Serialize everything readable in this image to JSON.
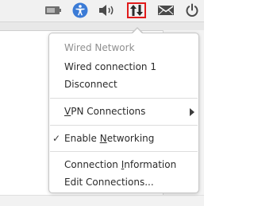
{
  "panel": {
    "icons": [
      {
        "name": "battery-icon",
        "color": "#5a5a5a"
      },
      {
        "name": "accessibility-icon",
        "color": "#3b7bd6"
      },
      {
        "name": "volume-icon",
        "color": "#4a4a4a"
      },
      {
        "name": "network-icon",
        "color": "#2b2b2b",
        "highlight": "#e01b1b"
      },
      {
        "name": "mail-icon",
        "color": "#4a4a4a"
      },
      {
        "name": "power-icon",
        "color": "#4a4a4a"
      }
    ]
  },
  "menu": {
    "header": "Wired Network",
    "wired_connection": "Wired connection 1",
    "disconnect": "Disconnect",
    "vpn_underline": "V",
    "vpn_rest": "PN Connections",
    "enable_prefix": "Enable ",
    "enable_underline": "N",
    "enable_rest": "etworking",
    "enable_checked": "✓",
    "info_prefix": "Connection ",
    "info_underline": "I",
    "info_rest": "nformation",
    "edit_connections": "Edit Connections..."
  }
}
